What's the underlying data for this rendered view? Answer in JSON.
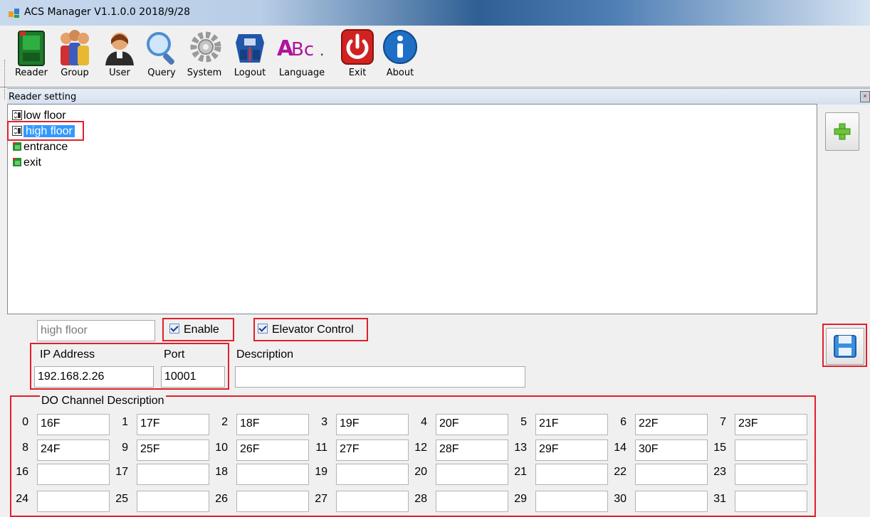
{
  "window": {
    "title": "ACS Manager V1.1.0.0 2018/9/28"
  },
  "toolbar": {
    "buttons": [
      {
        "label": "Reader",
        "icon": "reader-icon"
      },
      {
        "label": "Group",
        "icon": "group-icon"
      },
      {
        "label": "User",
        "icon": "user-icon"
      },
      {
        "label": "Query",
        "icon": "query-icon"
      },
      {
        "label": "System",
        "icon": "gear-icon"
      },
      {
        "label": "Logout",
        "icon": "logout-icon"
      },
      {
        "label": "Language",
        "icon": "language-icon"
      },
      {
        "label": "Exit",
        "icon": "power-icon"
      },
      {
        "label": "About",
        "icon": "info-icon"
      }
    ]
  },
  "panel": {
    "title": "Reader setting"
  },
  "tree": {
    "items": [
      {
        "label": "low floor"
      },
      {
        "label": "high floor",
        "selected": true
      },
      {
        "label": "entrance"
      },
      {
        "label": "exit"
      }
    ]
  },
  "form": {
    "name_value": "high floor",
    "enable_label": "Enable",
    "elevator_label": "Elevator Control",
    "ip_label": "IP Address",
    "port_label": "Port",
    "desc_label": "Description",
    "ip_value": "192.168.2.26",
    "port_value": "10001",
    "desc_value": ""
  },
  "do_channels": {
    "title": "DO Channel Description",
    "values": [
      "16F",
      "17F",
      "18F",
      "19F",
      "20F",
      "21F",
      "22F",
      "23F",
      "24F",
      "25F",
      "26F",
      "27F",
      "28F",
      "29F",
      "30F",
      "",
      "",
      "",
      "",
      "",
      "",
      "",
      "",
      "",
      "",
      "",
      "",
      "",
      "",
      "",
      "",
      ""
    ]
  },
  "colors": {
    "highlight": "#e0202a",
    "selection": "#3399ff"
  }
}
